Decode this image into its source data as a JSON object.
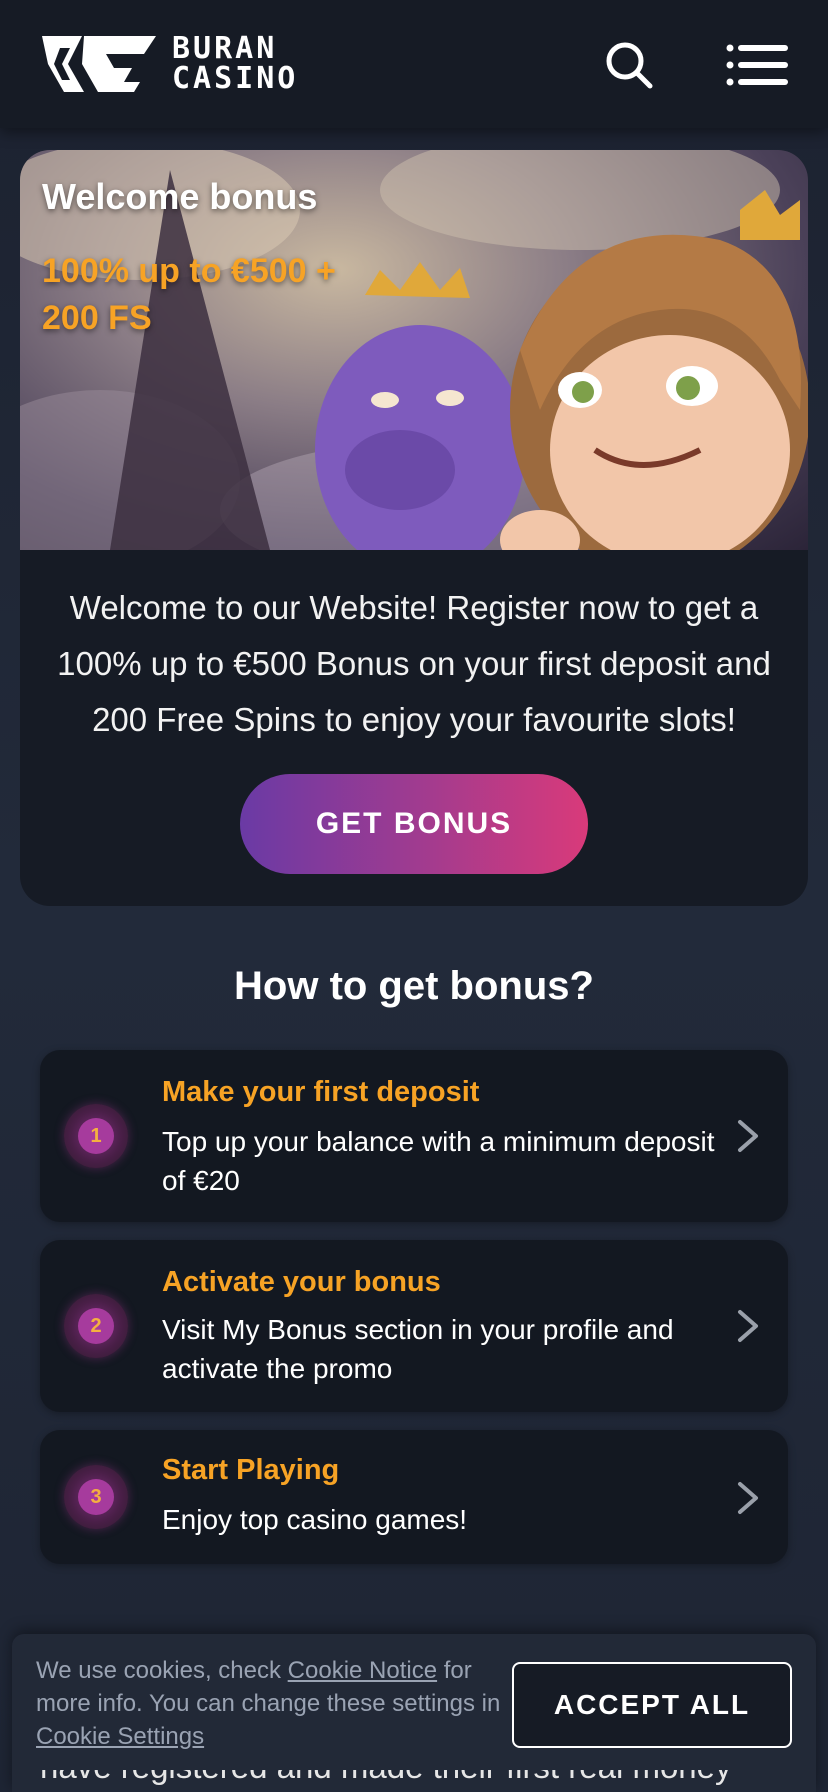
{
  "header": {
    "brand_line1": "BURAN",
    "brand_line2": "CASINO"
  },
  "bonus_card": {
    "title": "Welcome bonus",
    "offer": "100% up to €500 + 200 FS",
    "description": "Welcome to our Website! Register now to get a 100% up to €500 Bonus on your first deposit and 200 Free Spins to enjoy your favourite slots!",
    "button_label": "GET BONUS"
  },
  "how_to": {
    "title": "How to get bonus?",
    "steps": [
      {
        "number": "1",
        "title": "Make your first deposit",
        "text": "Top up your balance with a minimum deposit of €20"
      },
      {
        "number": "2",
        "title": "Activate your bonus",
        "text": "Visit My Bonus section in your profile and activate the promo"
      },
      {
        "number": "3",
        "title": "Start Playing",
        "text": "Enjoy top casino games!"
      }
    ]
  },
  "cookie_banner": {
    "text_before": "We use cookies, check ",
    "cookie_notice_link": "Cookie Notice",
    "text_middle": " for more info. You can change these settings in ",
    "cookie_settings_link": "Cookie Settings",
    "accept_label": "ACCEPT ALL"
  },
  "background_text": "have registered and made their first real money",
  "colors": {
    "accent_orange": "#f7a325",
    "header_bg": "#161b25",
    "button_gradient_start": "#6a3aa5",
    "button_gradient_end": "#d93a7a"
  },
  "icons": [
    "buran-logo-icon",
    "search-icon",
    "hamburger-menu-icon",
    "chevron-right-icon"
  ]
}
